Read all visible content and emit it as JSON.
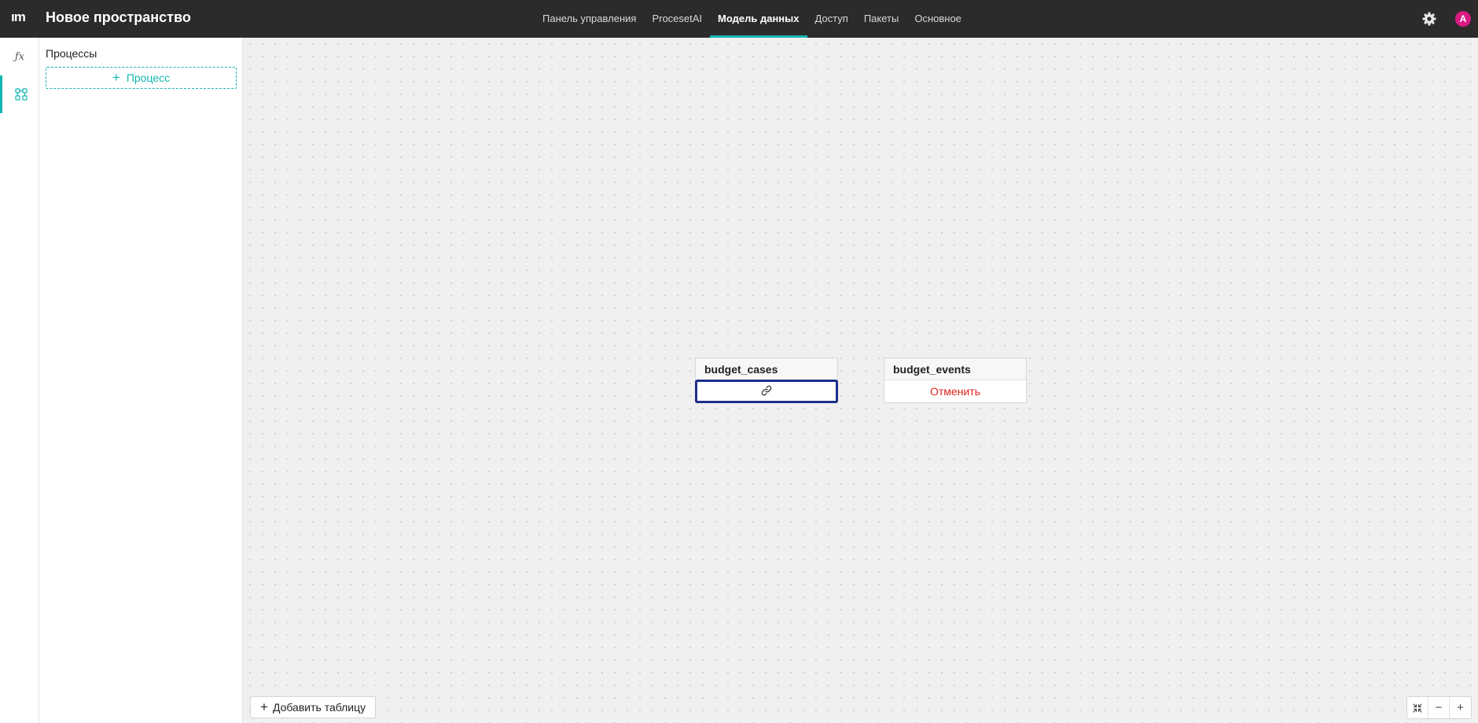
{
  "app": {
    "logo": "ım",
    "title": "Новое пространство"
  },
  "nav": {
    "tabs": [
      {
        "label": "Панель управления"
      },
      {
        "label": "ProcesetAI"
      },
      {
        "label": "Модель данных",
        "active": true
      },
      {
        "label": "Доступ"
      },
      {
        "label": "Пакеты"
      },
      {
        "label": "Основное"
      }
    ]
  },
  "user": {
    "avatar_letter": "A",
    "avatar_color": "#d81b83"
  },
  "rail": {
    "fx_label": "ƒx"
  },
  "panel": {
    "title": "Процессы",
    "add_button": "Процесс",
    "add_icon": "+"
  },
  "canvas": {
    "nodes": [
      {
        "name": "budget_cases",
        "action": "link-icon"
      },
      {
        "name": "budget_events",
        "action_label": "Отменить"
      }
    ],
    "add_table_label": "Добавить таблицу",
    "add_icon": "+",
    "zoom": {
      "minus": "−",
      "plus": "+"
    }
  },
  "colors": {
    "accent": "#12b5b0",
    "topbar": "#2b2b2b",
    "danger": "#e0221d",
    "link_focus": "#1d2f8a"
  }
}
